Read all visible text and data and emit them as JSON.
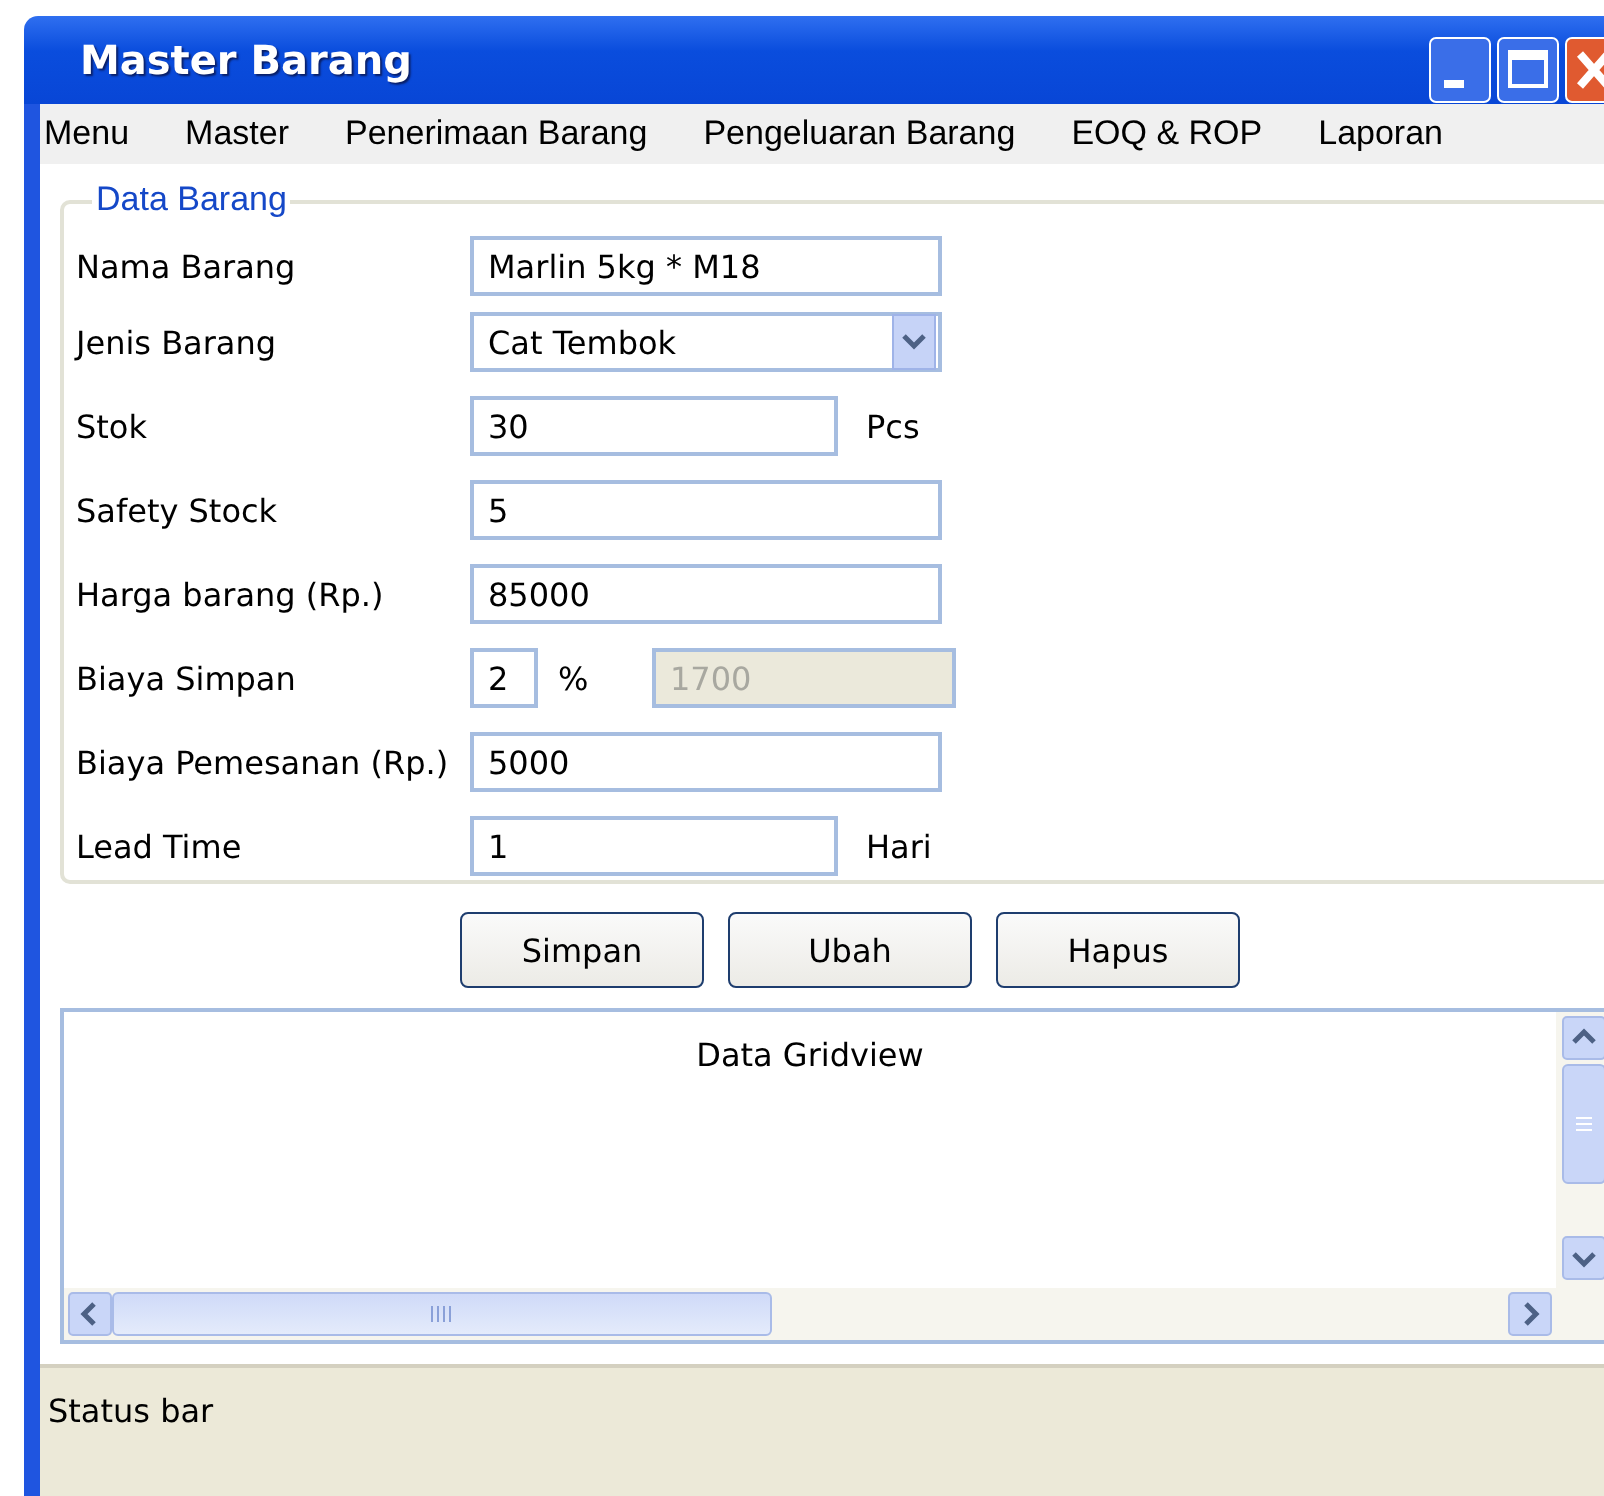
{
  "window": {
    "title": "Master Barang"
  },
  "menu": [
    "Menu",
    "Master",
    "Penerimaan Barang",
    "Pengeluaran Barang",
    "EOQ & ROP",
    "Laporan"
  ],
  "group": {
    "title": "Data Barang",
    "rows": [
      {
        "kind": "text",
        "label": "Nama Barang",
        "value": "Marlin 5kg * M18"
      },
      {
        "kind": "combo",
        "label": "Jenis Barang",
        "value": "Cat Tembok"
      },
      {
        "kind": "unit",
        "label": "Stok",
        "value": "30",
        "unit": "Pcs"
      },
      {
        "kind": "text",
        "label": "Safety Stock",
        "value": "5"
      },
      {
        "kind": "text",
        "label": "Harga barang (Rp.)",
        "value": "85000"
      },
      {
        "kind": "percent",
        "label": "Biaya Simpan",
        "value": "2",
        "unit": "%",
        "result": {
          "value": "1700",
          "disabled": true
        }
      },
      {
        "kind": "text",
        "label": "Biaya Pemesanan (Rp.)",
        "value": "5000"
      },
      {
        "kind": "unit",
        "label": "Lead Time",
        "value": "1",
        "unit": "Hari"
      }
    ]
  },
  "buttons": [
    "Simpan",
    "Ubah",
    "Hapus"
  ],
  "grid": {
    "caption": "Data Gridview"
  },
  "status_bar": "Status bar"
}
